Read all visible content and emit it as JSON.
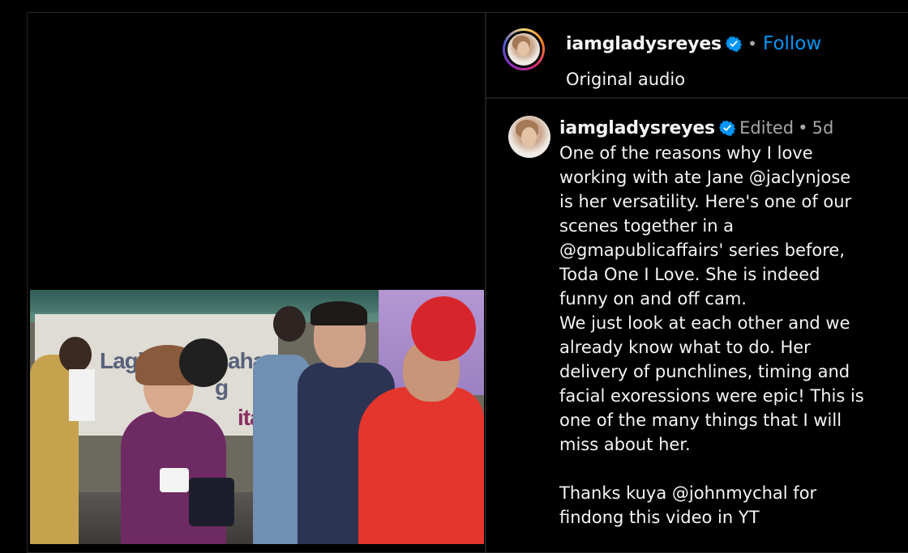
{
  "post": {
    "author": "iamgladysreyes",
    "follow_label": "Follow",
    "separator": "•",
    "audio": "Original audio",
    "more_label": "..."
  },
  "caption": {
    "author": "iamgladysreyes",
    "edited": "Edited",
    "separator": "•",
    "time_ago": "5d",
    "lines": [
      "One of the reasons why I love",
      "working with ate Jane @jaclynjose",
      "is her versatility. Here's one of our",
      "scenes together in a",
      "@gmapublicaffairs' series before,",
      "Toda One I Love. She is indeed",
      "funny on and off cam.",
      "We just look at each other and we",
      "already know what to do. Her",
      "delivery of punchlines, timing and",
      "facial exoressions were epic! This is",
      "one of the many things that I will",
      "miss about her.",
      "",
      "Thanks kuya @johnmychal for",
      "findong this video in YT"
    ]
  },
  "video": {
    "banner_partial_1": "Lagi",
    "banner_partial_2": "ahan",
    "banner_partial_3": "g",
    "banner_partial_4": "itar"
  },
  "colors": {
    "follow": "#0095f6",
    "verified": "#0095f6",
    "muted": "#a8a8a8",
    "text": "#f5f5f5",
    "background": "#000000"
  },
  "icons": {
    "verified": "verified-badge-icon",
    "more": "more-options-icon"
  }
}
